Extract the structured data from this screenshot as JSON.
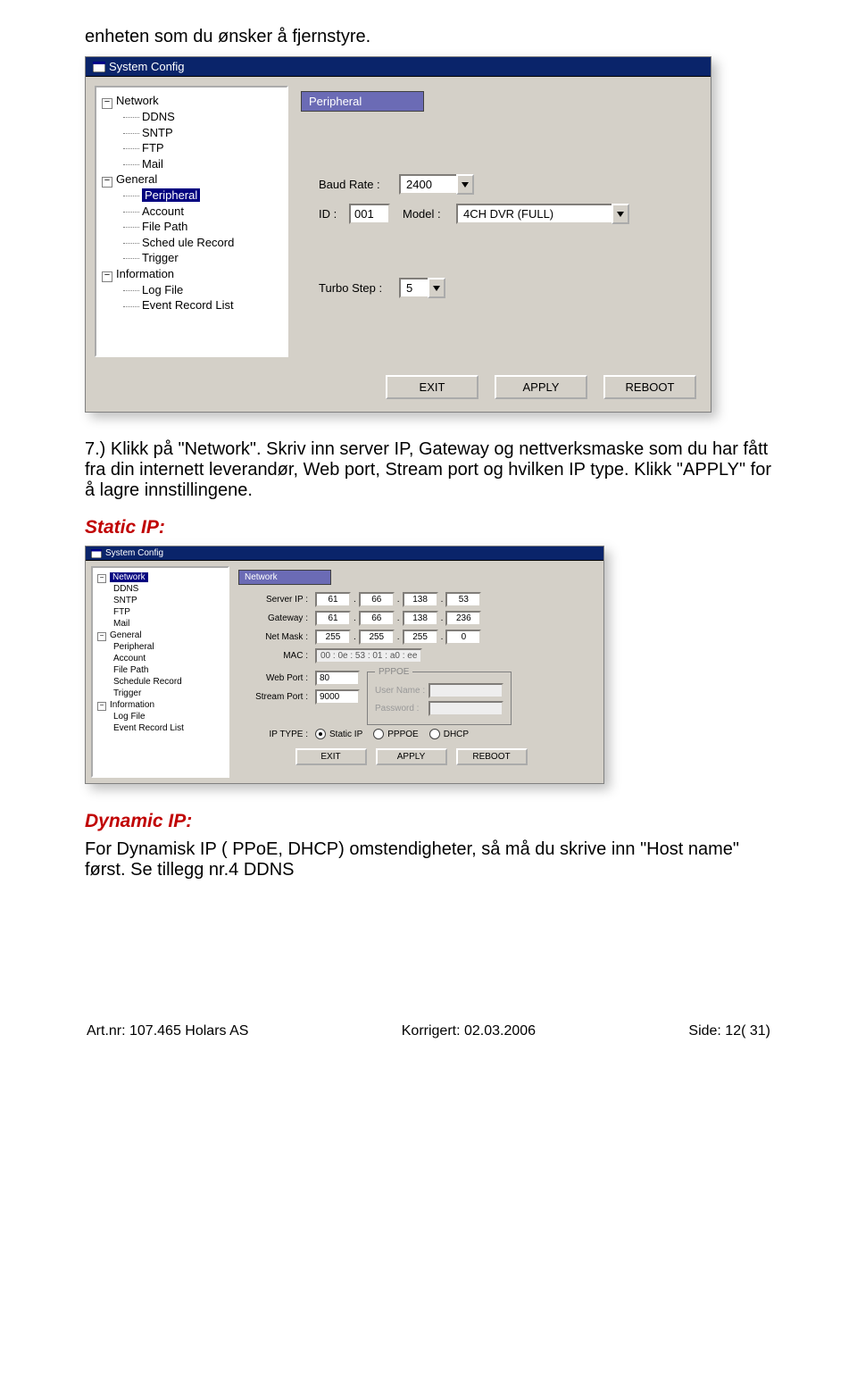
{
  "doc": {
    "line1": "enheten som du ønsker å fjernstyre.",
    "para2": "7.) Klikk på \"Network\". Skriv inn server IP, Gateway og nettverksmaske som du har fått fra din internett leverandør, Web port, Stream port og hvilken IP type. Klikk \"APPLY\" for å lagre innstillingene.",
    "para3": "For Dynamisk IP ( PPoE, DHCP) omstendigheter, så må du skrive inn \"Host name\" først. Se tillegg nr.4 DDNS"
  },
  "headings": {
    "static_ip": "Static IP:",
    "dynamic_ip": "Dynamic IP:"
  },
  "dialog1": {
    "title": "System Config",
    "section": "Peripheral",
    "tree": {
      "network": "Network",
      "ddns": "DDNS",
      "sntp": "SNTP",
      "ftp": "FTP",
      "mail": "Mail",
      "general": "General",
      "peripheral": "Peripheral",
      "account": "Account",
      "file_path": "File Path",
      "schedule_record": "Sched ule Record",
      "trigger": "Trigger",
      "information": "Information",
      "log_file": "Log File",
      "event_record_list": "Event Record List"
    },
    "labels": {
      "baud_rate": "Baud Rate :",
      "id": "ID :",
      "model": "Model :",
      "turbo_step": "Turbo Step :"
    },
    "values": {
      "baud_rate": "2400",
      "id": "001",
      "model": "4CH DVR (FULL)",
      "turbo_step": "5"
    },
    "buttons": {
      "exit": "EXIT",
      "apply": "APPLY",
      "reboot": "REBOOT"
    }
  },
  "dialog2": {
    "title": "System Config",
    "section": "Network",
    "tree": {
      "network": "Network",
      "ddns": "DDNS",
      "sntp": "SNTP",
      "ftp": "FTP",
      "mail": "Mail",
      "general": "General",
      "peripheral": "Peripheral",
      "account": "Account",
      "file_path": "File Path",
      "schedule_record": "Schedule Record",
      "trigger": "Trigger",
      "information": "Information",
      "log_file": "Log File",
      "event_record_list": "Event Record List"
    },
    "labels": {
      "server_ip": "Server IP :",
      "gateway": "Gateway :",
      "net_mask": "Net Mask :",
      "mac": "MAC :",
      "web_port": "Web Port :",
      "stream_port": "Stream Port :",
      "ip_type": "IP TYPE :",
      "pppoe": "PPPOE",
      "user_name": "User Name :",
      "password": "Password :"
    },
    "values": {
      "server_ip": [
        "61",
        "66",
        "138",
        "53"
      ],
      "gateway": [
        "61",
        "66",
        "138",
        "236"
      ],
      "net_mask": [
        "255",
        "255",
        "255",
        "0"
      ],
      "mac": "00 : 0e : 53 : 01 : a0 : ee",
      "web_port": "80",
      "stream_port": "9000"
    },
    "ip_type": {
      "static": "Static IP",
      "pppoe": "PPPOE",
      "dhcp": "DHCP"
    },
    "buttons": {
      "exit": "EXIT",
      "apply": "APPLY",
      "reboot": "REBOOT"
    }
  },
  "footer": {
    "left": "Art.nr: 107.465  Holars AS",
    "center": "Korrigert: 02.03.2006",
    "right": "Side: 12( 31)"
  }
}
